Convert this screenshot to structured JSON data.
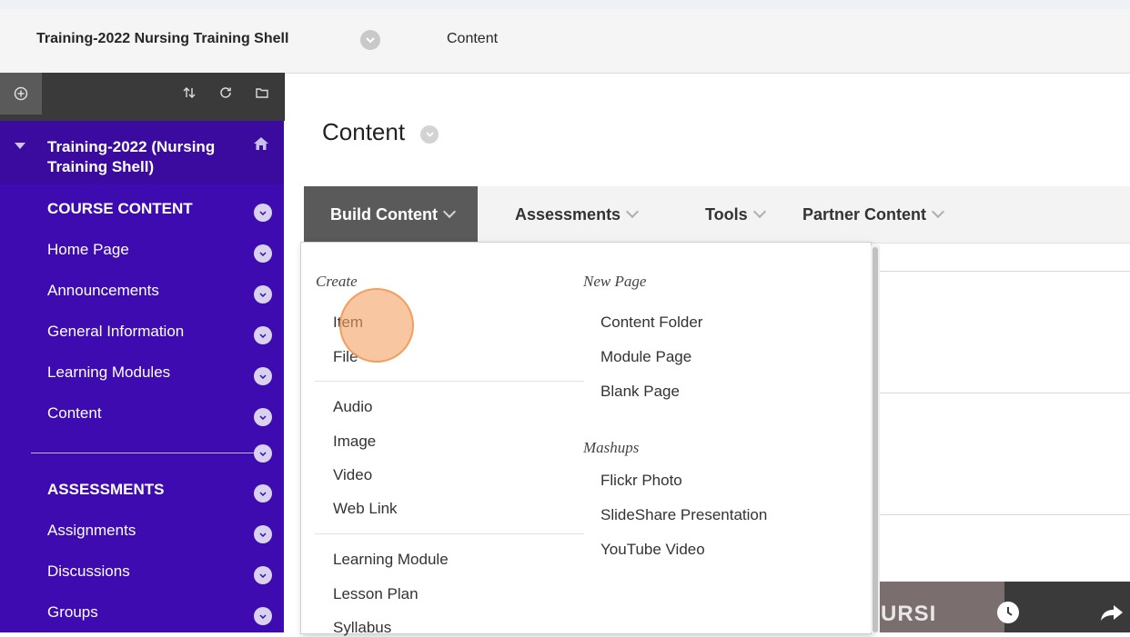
{
  "breadcrumb": {
    "course": "Training-2022 Nursing Training Shell",
    "current": "Content"
  },
  "sidebar": {
    "course_title": "Training-2022 (Nursing Training Shell)",
    "items": [
      {
        "label": "COURSE CONTENT",
        "heading": true
      },
      {
        "label": "Home Page"
      },
      {
        "label": "Announcements"
      },
      {
        "label": "General Information"
      },
      {
        "label": "Learning Modules"
      },
      {
        "label": "Content"
      },
      {
        "label": "ASSESSMENTS",
        "heading": true
      },
      {
        "label": "Assignments"
      },
      {
        "label": "Discussions"
      },
      {
        "label": "Groups"
      }
    ]
  },
  "main": {
    "title": "Content"
  },
  "actionbar": {
    "build": "Build Content",
    "assessments": "Assessments",
    "tools": "Tools",
    "partner": "Partner Content"
  },
  "dropdown": {
    "create_heading": "Create",
    "create_items": [
      "Item",
      "File"
    ],
    "media_items": [
      "Audio",
      "Image",
      "Video",
      "Web Link"
    ],
    "module_items": [
      "Learning Module",
      "Lesson Plan",
      "Syllabus"
    ],
    "newpage_heading": "New Page",
    "newpage_items": [
      "Content Folder",
      "Module Page",
      "Blank Page"
    ],
    "mashups_heading": "Mashups",
    "mashups_items": [
      "Flickr Photo",
      "SlideShare Presentation",
      "YouTube Video"
    ]
  },
  "video_preview": {
    "text": "URSI"
  },
  "colors": {
    "sidebar": "#3d0bb0",
    "toolbar": "#3a3a3a",
    "active_tab": "#5a5a5a",
    "click_marker": "#f4a060"
  }
}
